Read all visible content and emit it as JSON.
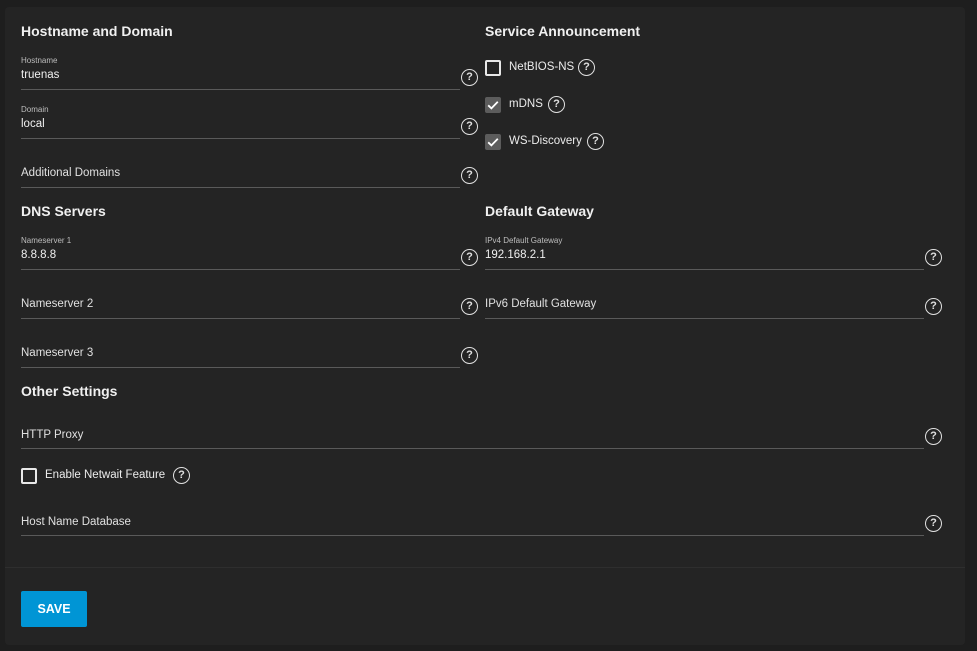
{
  "sections": {
    "hostname_domain": "Hostname and Domain",
    "service_announcement": "Service Announcement",
    "dns_servers": "DNS Servers",
    "default_gateway": "Default Gateway",
    "other_settings": "Other Settings"
  },
  "fields": {
    "hostname": {
      "label": "Hostname",
      "value": "truenas"
    },
    "domain": {
      "label": "Domain",
      "value": "local"
    },
    "additional_domains": {
      "placeholder": "Additional Domains"
    },
    "nameserver1": {
      "label": "Nameserver 1",
      "value": "8.8.8.8"
    },
    "nameserver2": {
      "placeholder": "Nameserver 2"
    },
    "nameserver3": {
      "placeholder": "Nameserver 3"
    },
    "ipv4_gateway": {
      "label": "IPv4 Default Gateway",
      "value": "192.168.2.1"
    },
    "ipv6_gateway": {
      "placeholder": "IPv6 Default Gateway"
    },
    "http_proxy": {
      "placeholder": "HTTP Proxy"
    },
    "host_name_database": {
      "placeholder": "Host Name Database"
    }
  },
  "checkboxes": {
    "netbios_ns": {
      "label": "NetBIOS-NS",
      "checked": false
    },
    "mdns": {
      "label": "mDNS",
      "checked": true
    },
    "ws_discovery": {
      "label": "WS-Discovery",
      "checked": true
    },
    "netwait": {
      "label": "Enable Netwait Feature",
      "checked": false
    }
  },
  "help_glyph": "?",
  "actions": {
    "save_label": "SAVE"
  },
  "colors": {
    "accent": "#0095d5",
    "background": "#1e1e1e",
    "card": "#242424"
  }
}
